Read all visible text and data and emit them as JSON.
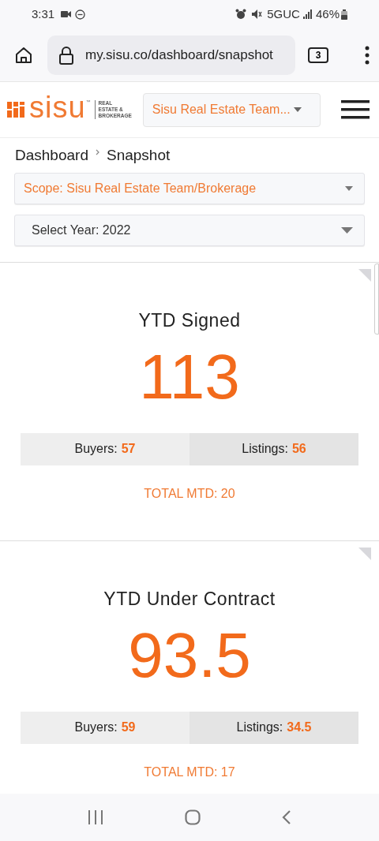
{
  "status_bar": {
    "time": "3:31",
    "network": "5GUC",
    "battery": "46%"
  },
  "browser": {
    "url": "my.sisu.co/dashboard/snapshot",
    "tab_count": "3"
  },
  "header": {
    "logo": {
      "wordmark": "sisu",
      "trademark": "™",
      "tagline": [
        "REAL",
        "ESTATE &",
        "BROKERAGE"
      ]
    },
    "team_select": "Sisu Real Estate Team..."
  },
  "breadcrumb": [
    "Dashboard",
    "Snapshot"
  ],
  "filters": [
    {
      "kind": "scope",
      "value": "Scope: Sisu Real Estate Team/Brokerage"
    },
    {
      "kind": "year",
      "value": "Select Year: 2022"
    }
  ],
  "cards": [
    {
      "title": "YTD Signed",
      "value": "113",
      "buyers_label": "Buyers:",
      "buyers": "57",
      "listings_label": "Listings:",
      "listings": "56",
      "total_mtd": "TOTAL MTD: 20"
    },
    {
      "title": "YTD Under Contract",
      "value": "93.5",
      "buyers_label": "Buyers:",
      "buyers": "59",
      "listings_label": "Listings:",
      "listings": "34.5",
      "total_mtd": "TOTAL MTD: 17"
    }
  ]
}
